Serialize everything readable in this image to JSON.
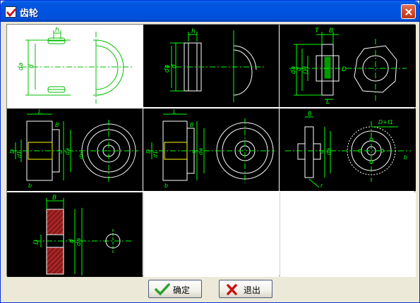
{
  "window": {
    "title": "齿轮",
    "icons": {
      "app": "checkmark-app-icon",
      "close": "close-icon"
    }
  },
  "thumbnails": [
    {
      "id": "gear-type-1",
      "labels": [
        "h",
        "da",
        "d"
      ]
    },
    {
      "id": "gear-type-2",
      "labels": [
        "h",
        "da",
        "d"
      ]
    },
    {
      "id": "gear-type-3",
      "labels": [
        "T",
        "B",
        "da",
        "d",
        "D1",
        "D",
        "L"
      ]
    },
    {
      "id": "gear-type-4",
      "labels": [
        "L",
        "B",
        "D",
        "d",
        "da",
        "b",
        "d1",
        "dn"
      ]
    },
    {
      "id": "gear-type-5",
      "labels": [
        "L",
        "B",
        "D",
        "d",
        "da",
        "b",
        "d1"
      ]
    },
    {
      "id": "gear-type-6",
      "labels": [
        "B",
        "D+t1",
        "d",
        "da",
        "b",
        "r"
      ]
    },
    {
      "id": "gear-type-7",
      "labels": [
        "B",
        "D",
        "d",
        "da"
      ]
    }
  ],
  "buttons": {
    "ok": {
      "label": "确定",
      "icon": "green-check-icon"
    },
    "exit": {
      "label": "退出",
      "icon": "red-x-icon"
    }
  },
  "colors": {
    "green": "#00ff00",
    "white": "#ffffff",
    "yellow": "#ffff00",
    "red": "#ff3030",
    "hatch": "#8b1a1a"
  }
}
